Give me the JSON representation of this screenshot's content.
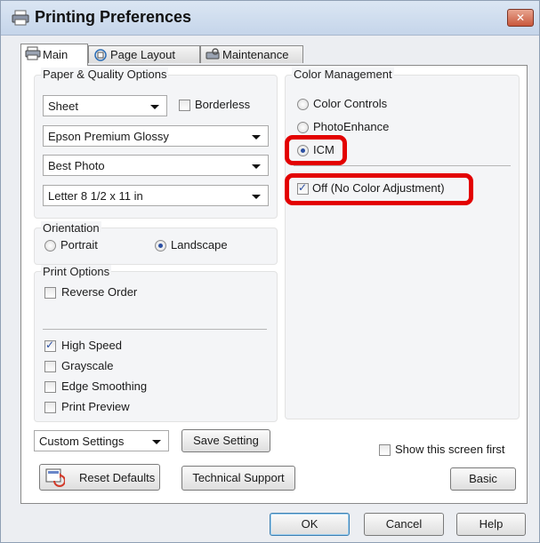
{
  "window": {
    "title": "Printing Preferences",
    "close_symbol": "✕"
  },
  "tabs": [
    {
      "label": "Main",
      "icon": "printer-icon"
    },
    {
      "label": "Page Layout",
      "icon": "page-layout-icon"
    },
    {
      "label": "Maintenance",
      "icon": "maintenance-icon"
    }
  ],
  "paper_quality": {
    "group_label": "Paper & Quality Options",
    "source_value": "Sheet",
    "borderless_label": "Borderless",
    "borderless_checked": false,
    "paper_type_value": "Epson Premium Glossy",
    "quality_value": "Best Photo",
    "size_value": "Letter 8 1/2 x 11 in"
  },
  "orientation": {
    "group_label": "Orientation",
    "portrait_label": "Portrait",
    "landscape_label": "Landscape",
    "selected": "Landscape"
  },
  "print_options": {
    "group_label": "Print Options",
    "reverse_order_label": "Reverse Order",
    "high_speed_label": "High Speed",
    "grayscale_label": "Grayscale",
    "edge_smoothing_label": "Edge Smoothing",
    "print_preview_label": "Print Preview",
    "checked": [
      "High Speed"
    ]
  },
  "settings": {
    "custom_settings_value": "Custom Settings",
    "save_setting_label": "Save Setting",
    "reset_defaults_label": "Reset Defaults",
    "technical_support_label": "Technical Support"
  },
  "color_management": {
    "group_label": "Color Management",
    "color_controls_label": "Color Controls",
    "photo_enhance_label": "PhotoEnhance",
    "icm_label": "ICM",
    "selected": "ICM",
    "off_label": "Off (No Color Adjustment)",
    "off_checked": true
  },
  "show_screen_first_label": "Show this screen first",
  "basic_label": "Basic",
  "footer": {
    "ok_label": "OK",
    "cancel_label": "Cancel",
    "help_label": "Help"
  },
  "colors": {
    "highlight": "#e30000",
    "accent": "#2b4fa2",
    "titlebar": "#c5d5ea"
  }
}
